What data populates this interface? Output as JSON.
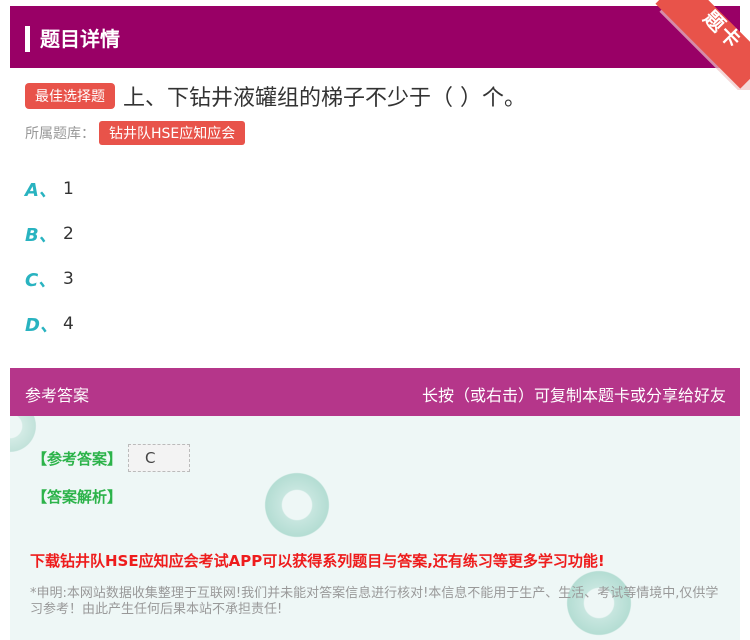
{
  "header": {
    "title": "题目详情",
    "corner_label": "题卡"
  },
  "question": {
    "type_tag": "最佳选择题",
    "text": "上、下钻井液罐组的梯子不少于（ ）个。",
    "source_label": "所属题库：",
    "source_tag": "钻井队HSE应知应会"
  },
  "options": [
    {
      "letter": "A、",
      "value": "1"
    },
    {
      "letter": "B、",
      "value": "2"
    },
    {
      "letter": "C、",
      "value": "3"
    },
    {
      "letter": "D、",
      "value": "4"
    }
  ],
  "answer_bar": {
    "left": "参考答案",
    "right": "长按（或右击）可复制本题卡或分享给好友"
  },
  "answer": {
    "ref_label": "【参考答案】",
    "ref_value": "C",
    "analysis_label": "【答案解析】",
    "promo": "下载钻井队HSE应知应会考试APP可以获得系列题目与答案,还有练习等更多学习功能!",
    "disclaimer": "*申明:本网站数据收集整理于互联网!我们并未能对答案信息进行核对!本信息不能用于生产、生活、考试等情境中,仅供学习参考！由此产生任何后果本站不承担责任!"
  },
  "colors": {
    "header": "#990066",
    "accent": "#e8534a",
    "option_letter": "#29b3c0",
    "answer_bar": "#b5368a",
    "green": "#2cb34a",
    "red": "#ee1c1c"
  }
}
